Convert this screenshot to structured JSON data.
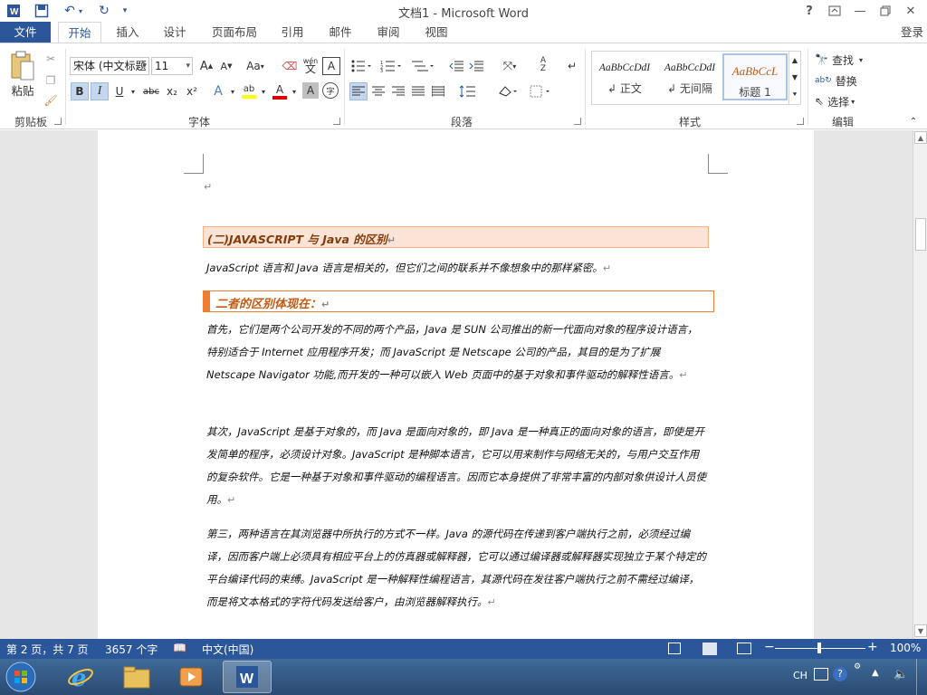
{
  "titlebar": {
    "title": "文档1 - Microsoft Word",
    "help": "?",
    "restore_ribbon": "⊡",
    "minimize": "—",
    "maximize": "🗗",
    "close": "✕",
    "word_icon": "W"
  },
  "tabs": {
    "file": "文件",
    "items": [
      "开始",
      "插入",
      "设计",
      "页面布局",
      "引用",
      "邮件",
      "审阅",
      "视图"
    ],
    "login": "登录"
  },
  "ribbon": {
    "clipboard": {
      "paste": "粘贴",
      "label": "剪贴板"
    },
    "font": {
      "font_name": "宋体 (中文标题",
      "font_size": "11",
      "grow": "A",
      "shrink": "A",
      "case": "Aa",
      "phonetic": "wén",
      "border_a": "A",
      "bold": "B",
      "italic": "I",
      "underline": "U",
      "strike": "abc",
      "sub": "x₂",
      "sup": "x²",
      "effects": "A",
      "highlight": "ab",
      "font_color": "A",
      "shading_a": "A",
      "enclose": "字",
      "label": "字体"
    },
    "paragraph": {
      "label": "段落"
    },
    "styles": {
      "items": [
        {
          "sample": "AaBbCcDdI",
          "name": "正文"
        },
        {
          "sample": "AaBbCcDdI",
          "name": "无间隔"
        },
        {
          "sample": "AaBbCcL",
          "name": "标题 1"
        }
      ],
      "label": "样式"
    },
    "editing": {
      "find": "查找",
      "replace": "替换",
      "select": "选择",
      "label": "编辑"
    }
  },
  "document": {
    "heading1": "(二)JAVASCRIPT 与 Java 的区别",
    "intro": "JavaScript 语言和 Java 语言是相关的，但它们之间的联系并不像想象中的那样紧密。",
    "heading2": "二者的区别体现在：",
    "p1": "首先，它们是两个公司开发的不同的两个产品，Java 是 SUN 公司推出的新一代面向对象的程序设计语言，特别适合于 Internet 应用程序开发；而 JavaScript 是 Netscape 公司的产品，其目的是为了扩展 Netscape Navigator 功能,而开发的一种可以嵌入 Web 页面中的基于对象和事件驱动的解释性语言。",
    "p2": "其次，JavaScript 是基于对象的，而 Java 是面向对象的，即 Java 是一种真正的面向对象的语言，即使是开发简单的程序，必须设计对象。JavaScript 是种脚本语言，它可以用来制作与网络无关的，与用户交互作用的复杂软件。它是一种基于对象和事件驱动的编程语言。因而它本身提供了非常丰富的内部对象供设计人员使用。",
    "p3": "第三，两种语言在其浏览器中所执行的方式不一样。Java 的源代码在传递到客户端执行之前，必须经过编译，因而客户端上必须具有相应平台上的仿真器或解释器，它可以通过编译器或解释器实现独立于某个特定的平台编译代码的束缚。JavaScript 是一种解释性编程语言，其源代码在发往客户端执行之前不需经过编译，而是将文本格式的字符代码发送给客户，由浏览器解释执行。",
    "mark": "↵"
  },
  "statusbar": {
    "page": "第 2 页，共 7 页",
    "words": "3657 个字",
    "language": "中文(中国)",
    "zoom": "100%",
    "zoom_minus": "−",
    "zoom_plus": "+"
  },
  "taskbar": {
    "input_method": "CH"
  },
  "colors": {
    "word_blue": "#2b579a",
    "heading_fill": "#fbe4d5",
    "heading_accent": "#ed7d31"
  }
}
